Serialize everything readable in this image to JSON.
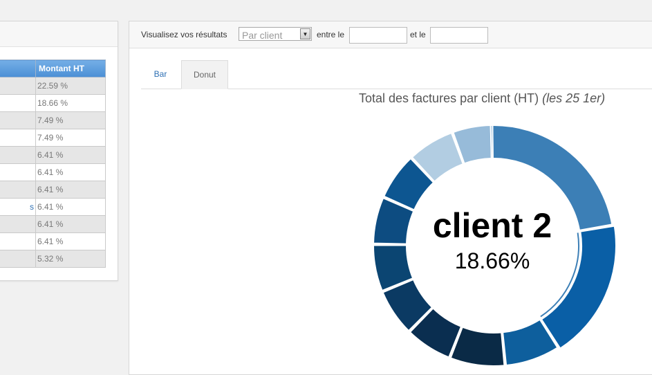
{
  "summary_table": {
    "column_header": "Montant HT",
    "rows": [
      {
        "name": "",
        "value": "22.59 %"
      },
      {
        "name": "",
        "value": "18.66 %"
      },
      {
        "name": "",
        "value": "7.49 %"
      },
      {
        "name": "",
        "value": "7.49 %"
      },
      {
        "name": "",
        "value": "6.41 %"
      },
      {
        "name": "",
        "value": "6.41 %"
      },
      {
        "name": "",
        "value": "6.41 %"
      },
      {
        "name": "s",
        "value": "6.41 %"
      },
      {
        "name": "",
        "value": "6.41 %"
      },
      {
        "name": "",
        "value": "6.41 %"
      },
      {
        "name": "",
        "value": "5.32 %"
      }
    ]
  },
  "filter_bar": {
    "label": "Visualisez vos résultats",
    "select_value": "Par client",
    "between_label": "entre le",
    "and_label": "et le",
    "date_from": "",
    "date_to": ""
  },
  "tabs": [
    {
      "label": "Bar",
      "active": false
    },
    {
      "label": "Donut",
      "active": true
    }
  ],
  "chart": {
    "title": "Total des factures par client (HT)",
    "subtitle": "(les 25 1er)",
    "center_label": "client 2",
    "center_value": "18.66%"
  },
  "chart_data": {
    "type": "pie",
    "subtype": "donut",
    "title": "Total des factures par client (HT)",
    "subtitle": "(les 25 1er)",
    "highlighted": {
      "label": "client 2",
      "value": 18.66
    },
    "values": [
      22.59,
      18.66,
      7.49,
      7.49,
      6.41,
      6.41,
      6.41,
      6.41,
      6.41,
      6.41,
      5.32
    ],
    "colors": [
      "#3c7fb6",
      "#0a5fa6",
      "#0e5f9d",
      "#0a2a46",
      "#0a2e50",
      "#0b3a63",
      "#0b4572",
      "#0d4c81",
      "#0d5691",
      "#b2cde2",
      "#97bbd9",
      "#6a9fcc"
    ]
  }
}
